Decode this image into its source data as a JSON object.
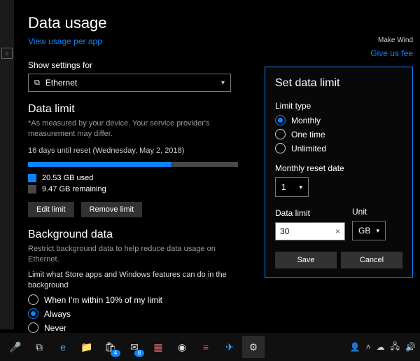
{
  "header": {
    "title": "Data usage",
    "usage_link": "View usage per app"
  },
  "top_right": {
    "make_windows": "Make Wind",
    "feedback": "Give us fee"
  },
  "settings_for": {
    "label": "Show settings for",
    "icon_name": "ethernet-icon",
    "value": "Ethernet"
  },
  "data_limit": {
    "heading": "Data limit",
    "note": "*As measured by your device. Your service provider's measurement may differ.",
    "reset_line": "16 days until reset (Wednesday, May 2, 2018)",
    "used": "20.53 GB used",
    "remaining": "9.47 GB remaining",
    "edit_btn": "Edit limit",
    "remove_btn": "Remove limit"
  },
  "background": {
    "heading": "Background data",
    "desc": "Restrict background data to help reduce data usage on Ethernet.",
    "question": "Limit what Store apps and Windows features can do in the background",
    "opt_within": "When I'm within 10% of my limit",
    "opt_always": "Always",
    "opt_never": "Never",
    "selected": "always"
  },
  "dialog": {
    "title": "Set data limit",
    "limit_type_label": "Limit type",
    "opt_monthly": "Monthly",
    "opt_onetime": "One time",
    "opt_unlimited": "Unlimited",
    "selected_type": "monthly",
    "reset_date_label": "Monthly reset date",
    "reset_date_value": "1",
    "data_limit_label": "Data limit",
    "data_limit_value": "30",
    "unit_label": "Unit",
    "unit_value": "GB",
    "save": "Save",
    "cancel": "Cancel"
  },
  "taskbar": {
    "mail_badge": "8",
    "store_badge": "4"
  }
}
